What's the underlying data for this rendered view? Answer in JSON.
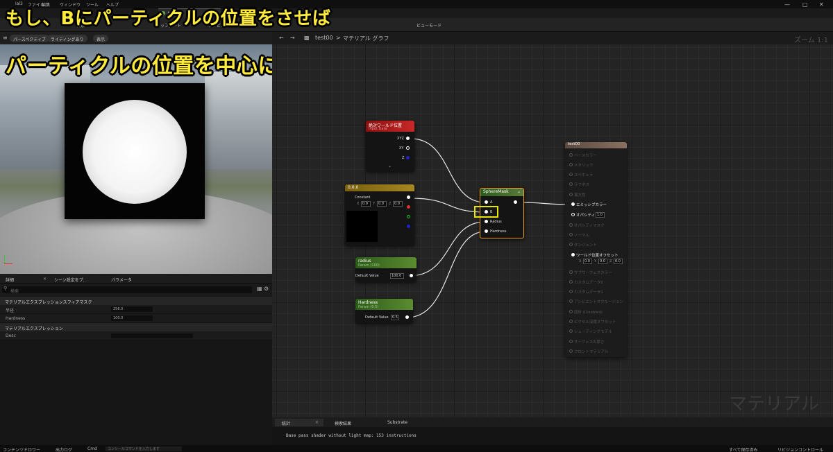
{
  "menu": {
    "items": [
      "ファイル",
      "編集",
      "ウィンドウ",
      "ツール",
      "ヘルプ"
    ],
    "file_prefix": "ial3"
  },
  "doc_tab": {
    "label": "test00"
  },
  "toolbar": {
    "items": [
      "保存",
      "検索",
      "アップデート",
      "プレビュー",
      "ビューモード"
    ]
  },
  "overlay": {
    "line1": "もし、Bにパーティクルの位置をさせば",
    "line2": "パーティクルの位置を中心に球を生成させる事ができます"
  },
  "viewport": {
    "perspective": "パースペクティブ",
    "lighting": "ライティングあり",
    "show": "表示"
  },
  "details": {
    "tabs": [
      "詳細",
      "シーン設定をプ..",
      "パラメータ"
    ],
    "search_placeholder": "検索",
    "cat1": "マテリアルエクスプレッションスフィアマスク",
    "props": [
      {
        "label": "半径",
        "value": "256.0"
      },
      {
        "label": "Hardness",
        "value": "100.0"
      }
    ],
    "cat2": "マテリアルエクスプレッション",
    "desc_label": "Desc"
  },
  "graph": {
    "breadcrumb_asset": "test00",
    "breadcrumb_sep": ">",
    "breadcrumb_graph": "マテリアル グラフ",
    "zoom": "ズーム 1:1",
    "watermark": "マテリアル"
  },
  "nodes": {
    "world_pos": {
      "title": "絶対ワールド位置",
      "subtitle": "Input Data",
      "pins": [
        "XYZ",
        "XY",
        "Z"
      ]
    },
    "constant": {
      "title": "0,0,0",
      "label": "Constant",
      "x": "0.0",
      "y": "0.0",
      "z": "0.0",
      "axis_x": "X",
      "axis_y": "Y",
      "axis_z": "Z"
    },
    "radius": {
      "title": "radius",
      "subtitle": "Param (100)",
      "label": "Default Value",
      "value": "100.0"
    },
    "hardness": {
      "title": "Hardness",
      "subtitle": "Param (0.5)",
      "label": "Default Value",
      "value": "0.5"
    },
    "sphere": {
      "title": "SphereMask",
      "pins": [
        "A",
        "B",
        "Radius",
        "Hardness"
      ]
    },
    "output": {
      "title": "test00",
      "rows": [
        "ベースカラー",
        "メタリック",
        "スペキュラ",
        "ラフネス",
        "異方性",
        "エミッシブカラー",
        "オパシティ",
        "オパシティマスク",
        "ノーマル",
        "タンジェント",
        "ワールド位置オフセット",
        "サブサーフェスカラー",
        "カスタムデータ0",
        "カスタムデータ1",
        "アンビエントオクルージョン",
        "屈折 (Disabled)",
        "ピクセル深度オフセット",
        "シェーディングモデル",
        "サーフェスの厚さ",
        "フロントマテリアル"
      ],
      "opacity_value": "1.0",
      "wpo": {
        "x": "0.0",
        "y": "0.0",
        "z": "0.0",
        "axis_x": "X",
        "axis_y": "Y",
        "axis_z": "Z"
      }
    }
  },
  "bottom": {
    "tabs": [
      "統計",
      "検索結果",
      "Substrate"
    ],
    "stats_line": "Base pass shader without light map: 153 instructions"
  },
  "status": {
    "content_drawer": "コンテンツドロワー",
    "output_log": "出力ログ",
    "cmd": "Cmd",
    "cmd_placeholder": "コンソールコマンドを入力します",
    "save_all": "すべて保存済み",
    "source_control": "リビジョンコントロール"
  }
}
